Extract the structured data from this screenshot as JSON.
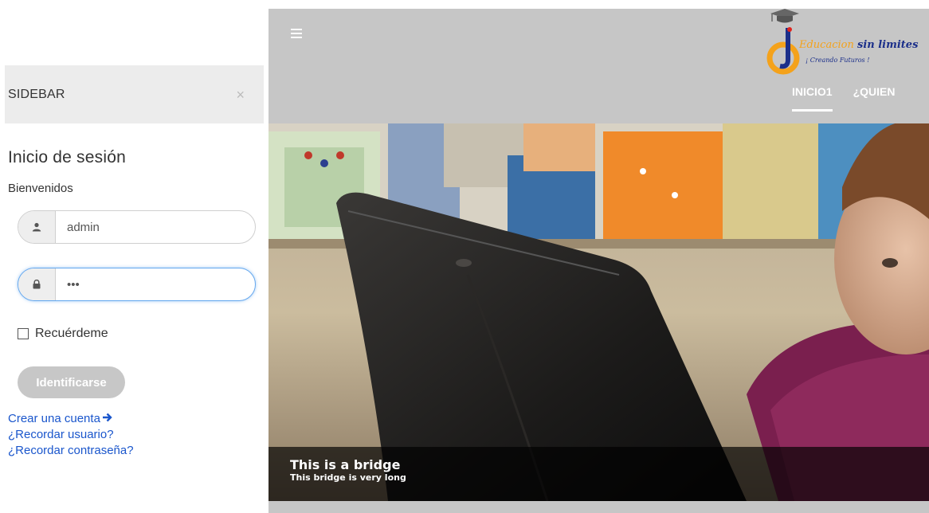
{
  "sidebar": {
    "title": "SIDEBAR",
    "close_symbol": "×",
    "login": {
      "heading": "Inicio de sesión",
      "subheading": "Bienvenidos",
      "username_value": "admin",
      "username_icon": "user-icon",
      "password_value": "•••",
      "password_icon": "lock-icon",
      "remember_label": "Recuérdeme",
      "remember_checked": false,
      "submit_label": "Identificarse"
    },
    "links": {
      "create_account": "Crear una cuenta",
      "create_account_icon": "arrow-right-icon",
      "remember_user": "¿Recordar usuario?",
      "remember_password": "¿Recordar contraseña?"
    }
  },
  "header": {
    "menu_icon": "hamburger-icon",
    "logo": {
      "text_part1": "Educacion",
      "text_part2": "sin limites",
      "tagline": "¡ Creando Futuros !"
    },
    "nav": [
      "INICIO1",
      "¿QUIEN"
    ]
  },
  "slider": {
    "caption_title": "This is a bridge",
    "caption_text": "This bridge is very long"
  },
  "colors": {
    "header_bg": "#c6c6c6",
    "link": "#1a56cc",
    "focus_ring": "#66a8ee",
    "logo_orange": "#f4a21b",
    "logo_blue": "#1b2f8a"
  }
}
